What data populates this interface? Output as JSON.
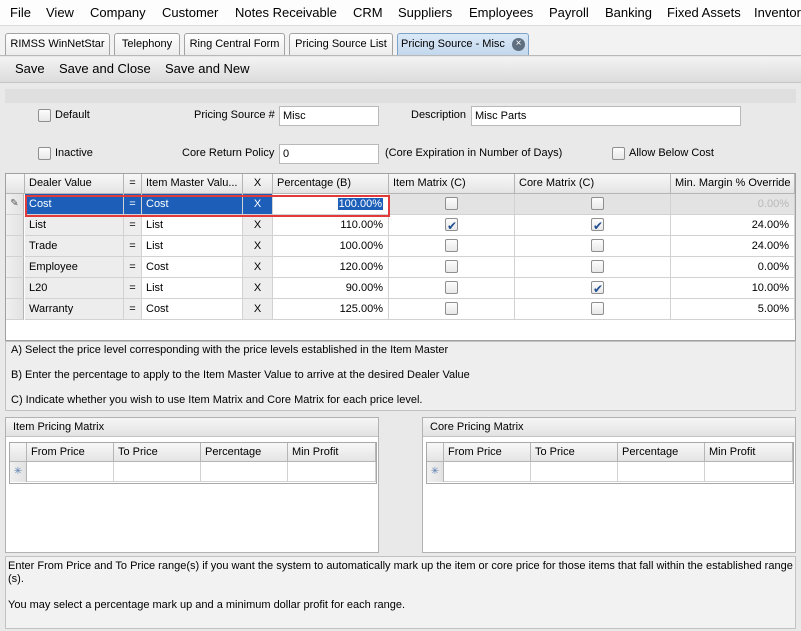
{
  "menu": [
    "File",
    "View",
    "Company",
    "Customer",
    "Notes Receivable",
    "CRM",
    "Suppliers",
    "Employees",
    "Payroll",
    "Banking",
    "Fixed Assets",
    "Inventory"
  ],
  "tabs": [
    "RIMSS WinNetStar",
    "Telephony",
    "Ring Central Form",
    "Pricing Source List",
    "Pricing Source - Misc"
  ],
  "tab_close_icon": "×",
  "toolbar": {
    "save": "Save",
    "save_close": "Save and Close",
    "save_new": "Save and New"
  },
  "form": {
    "default_label": "Default",
    "inactive_label": "Inactive",
    "pricing_source_label": "Pricing Source #",
    "pricing_source_value": "Misc",
    "description_label": "Description",
    "description_value": "Misc Parts",
    "core_return_label": "Core Return Policy",
    "core_return_value": "0",
    "core_expiration_note": "(Core Expiration in Number of Days)",
    "allow_below_cost_label": "Allow Below Cost"
  },
  "grid": {
    "headers": [
      "Dealer Value",
      "=",
      "Item Master Valu...",
      "X",
      "Percentage (B)",
      "Item Matrix (C)",
      "Core Matrix (C)",
      "Min. Margin % Override"
    ],
    "edit_icon": "✎",
    "rows": [
      {
        "dealer": "Cost",
        "eq": "=",
        "master": "Cost",
        "x": "X",
        "pct": "100.00%",
        "item_matrix": false,
        "core_matrix": false,
        "min_margin": "0.00%"
      },
      {
        "dealer": "List",
        "eq": "=",
        "master": "List",
        "x": "X",
        "pct": "110.00%",
        "item_matrix": true,
        "core_matrix": true,
        "min_margin": "24.00%"
      },
      {
        "dealer": "Trade",
        "eq": "=",
        "master": "List",
        "x": "X",
        "pct": "100.00%",
        "item_matrix": false,
        "core_matrix": false,
        "min_margin": "24.00%"
      },
      {
        "dealer": "Employee",
        "eq": "=",
        "master": "Cost",
        "x": "X",
        "pct": "120.00%",
        "item_matrix": false,
        "core_matrix": false,
        "min_margin": "0.00%"
      },
      {
        "dealer": "L20",
        "eq": "=",
        "master": "List",
        "x": "X",
        "pct": "90.00%",
        "item_matrix": false,
        "core_matrix": true,
        "min_margin": "10.00%"
      },
      {
        "dealer": "Warranty",
        "eq": "=",
        "master": "Cost",
        "x": "X",
        "pct": "125.00%",
        "item_matrix": false,
        "core_matrix": false,
        "min_margin": "5.00%"
      }
    ]
  },
  "notes": [
    "A)  Select the price level corresponding with the price levels established in the Item Master",
    "B)  Enter the percentage to apply to the Item Master Value to arrive at the desired Dealer Value",
    "C)  Indicate whether you wish to use Item Matrix and Core Matrix for each price level."
  ],
  "item_matrix": {
    "title": "Item Pricing Matrix",
    "headers": [
      "From Price",
      "To Price",
      "Percentage",
      "Min Profit"
    ]
  },
  "core_matrix": {
    "title": "Core Pricing Matrix",
    "headers": [
      "From Price",
      "To Price",
      "Percentage",
      "Min Profit"
    ]
  },
  "new_row_icon": "✳",
  "footer": {
    "line1": "Enter From Price and To Price range(s) if you want the system to automatically mark up the item or core price for those items that fall within the established range",
    "line1b": "(s).",
    "line2": "You may select a percentage mark up and a minimum dollar profit for each range."
  }
}
